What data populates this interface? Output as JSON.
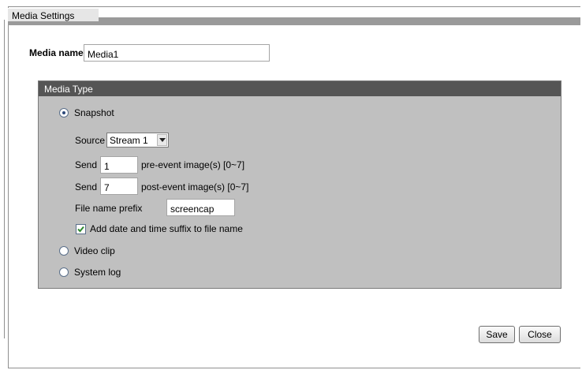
{
  "panel": {
    "title": "Media Settings"
  },
  "media_name": {
    "label": "Media name",
    "value": "Media1"
  },
  "media_type": {
    "header": "Media Type",
    "snapshot": {
      "label": "Snapshot",
      "selected": true,
      "source_label": "Source",
      "source_value": "Stream 1",
      "send_pre": {
        "label": "Send",
        "value": "1",
        "suffix": "pre-event image(s) [0~7]"
      },
      "send_post": {
        "label": "Send",
        "value": "7",
        "suffix": "post-event image(s) [0~7]"
      },
      "prefix_label": "File name prefix",
      "prefix_value": "screencap",
      "add_suffix_label": "Add date and time suffix to file name",
      "add_suffix_checked": true
    },
    "video_clip": {
      "label": "Video clip",
      "selected": false
    },
    "system_log": {
      "label": "System log",
      "selected": false
    }
  },
  "buttons": {
    "save": "Save",
    "close": "Close"
  },
  "icons": [
    "radio-icon",
    "dropdown-arrow-icon",
    "checkmark-icon"
  ]
}
